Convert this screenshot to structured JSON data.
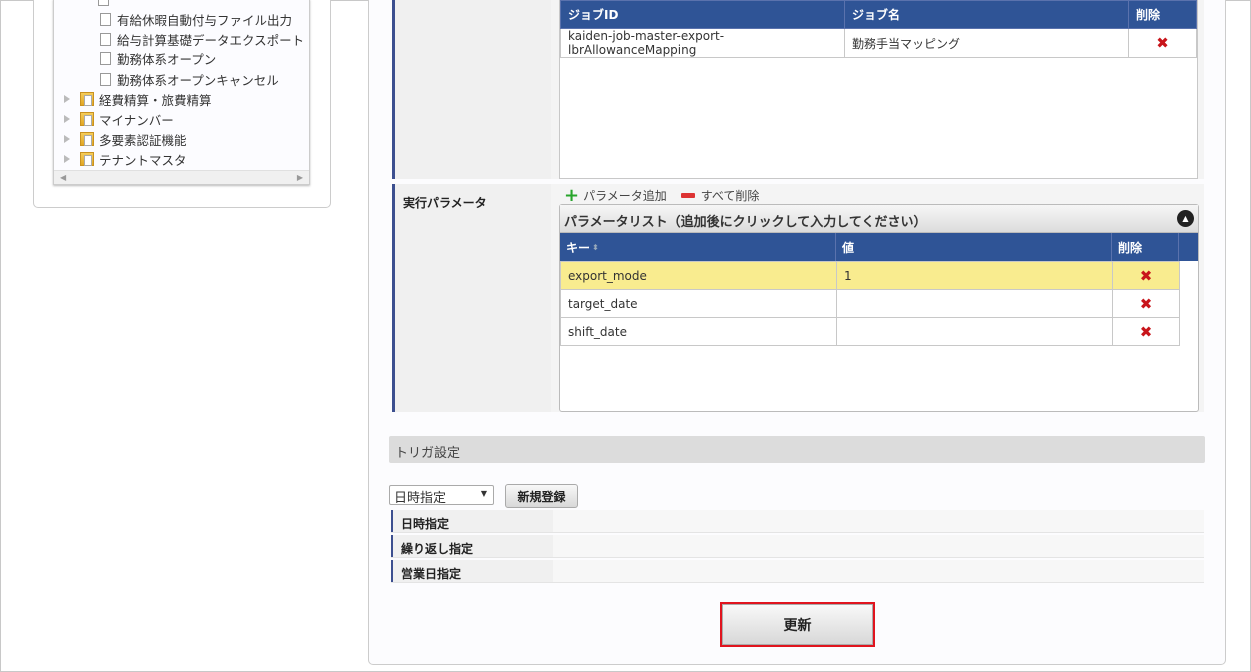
{
  "tree": {
    "files": [
      "有給休暇自動付与ファイル出力",
      "給与計算基礎データエクスポート",
      "勤務体系オープン",
      "勤務体系オープンキャンセル"
    ],
    "folders": [
      "経費精算・旅費精算",
      "マイナンバー",
      "多要素認証機能",
      "テナントマスタ"
    ]
  },
  "job": {
    "label": "",
    "headers": [
      "ジョブID",
      "ジョブ名",
      "削除"
    ],
    "rows": [
      {
        "id": "kaiden-job-master-export-lbrAllowanceMapping",
        "name": "勤務手当マッピング"
      }
    ]
  },
  "params": {
    "label": "実行パラメータ",
    "add_label": "パラメータ追加",
    "delete_all_label": "すべて削除",
    "list_title": "パラメータリスト（追加後にクリックして入力してください）",
    "headers": [
      "キー",
      "値",
      "削除"
    ],
    "rows": [
      {
        "key": "export_mode",
        "value": "1",
        "selected": true
      },
      {
        "key": "target_date",
        "value": ""
      },
      {
        "key": "shift_date",
        "value": ""
      }
    ]
  },
  "trigger": {
    "title": "トリガ設定",
    "select_value": "日時指定",
    "new_button": "新規登録",
    "rows": [
      "日時指定",
      "繰り返し指定",
      "営業日指定"
    ]
  },
  "update_button": "更新",
  "colors": {
    "header_blue": "#2f5496",
    "selected_row": "#f9ec8f",
    "delete_red": "#c8151b",
    "highlight_border": "#e0141e"
  }
}
